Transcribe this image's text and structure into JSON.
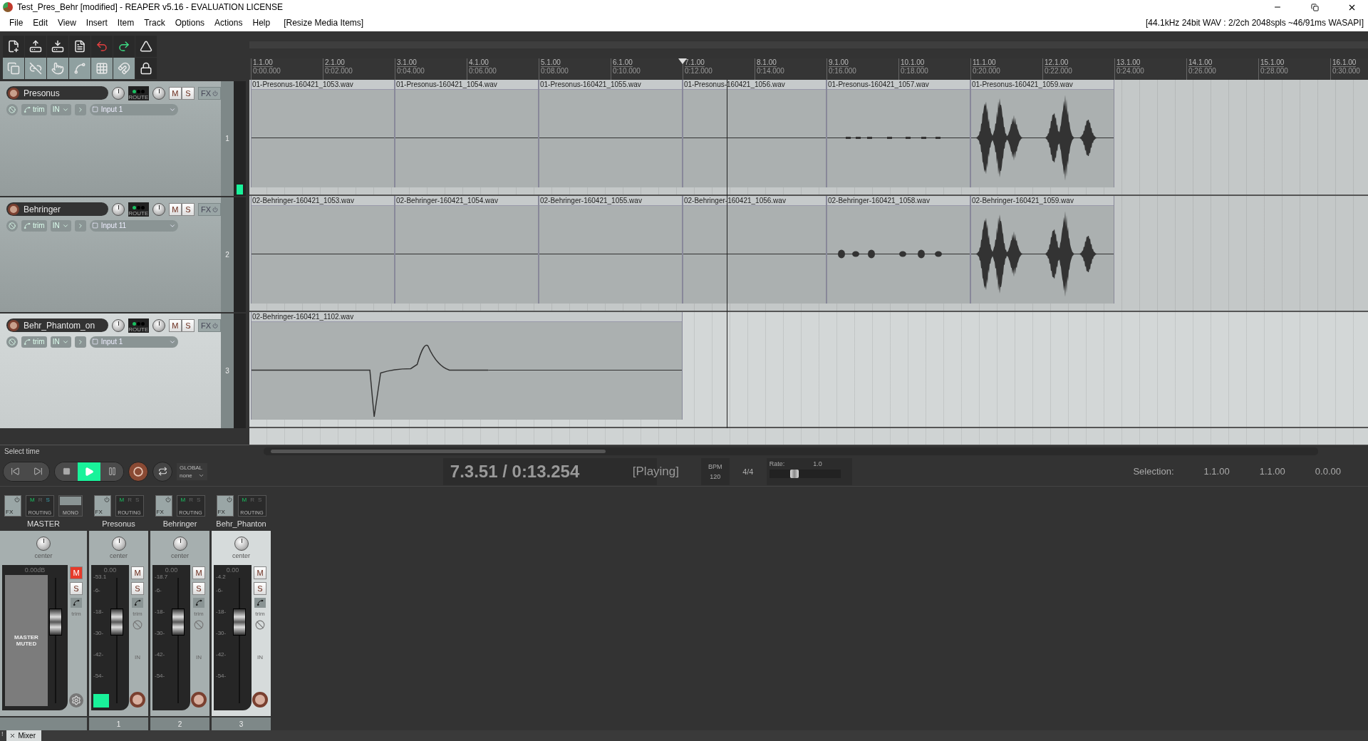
{
  "window": {
    "title": "Test_Pres_Behr [modified] - REAPER v5.16 - EVALUATION LICENSE",
    "device_info": "[44.1kHz 24bit WAV : 2/2ch 2048spls ~46/91ms WASAPI]"
  },
  "menu": [
    "File",
    "Edit",
    "View",
    "Insert",
    "Item",
    "Track",
    "Options",
    "Actions",
    "Help"
  ],
  "menu_extra": "[Resize Media Items]",
  "ruler": [
    {
      "bar": "1.1.00",
      "time": "0:00.000"
    },
    {
      "bar": "2.1.00",
      "time": "0:02.000"
    },
    {
      "bar": "3.1.00",
      "time": "0:04.000"
    },
    {
      "bar": "4.1.00",
      "time": "0:06.000"
    },
    {
      "bar": "5.1.00",
      "time": "0:08.000"
    },
    {
      "bar": "6.1.00",
      "time": "0:10.000"
    },
    {
      "bar": "7.1.00",
      "time": "0:12.000"
    },
    {
      "bar": "8.1.00",
      "time": "0:14.000"
    },
    {
      "bar": "9.1.00",
      "time": "0:16.000"
    },
    {
      "bar": "10.1.00",
      "time": "0:18.000"
    },
    {
      "bar": "11.1.00",
      "time": "0:20.000"
    },
    {
      "bar": "12.1.00",
      "time": "0:22.000"
    },
    {
      "bar": "13.1.00",
      "time": "0:24.000"
    },
    {
      "bar": "14.1.00",
      "time": "0:26.000"
    },
    {
      "bar": "15.1.00",
      "time": "0:28.000"
    },
    {
      "bar": "16.1.00",
      "time": "0:30.000"
    }
  ],
  "tracks": [
    {
      "name": "Presonus",
      "number": "1",
      "selected": false,
      "route_label": "ROUTE",
      "mute_label": "M",
      "solo_label": "S",
      "fx_label": "FX",
      "trim_label": "trim",
      "in_label": "IN",
      "input": "Input 1",
      "items": [
        {
          "name": "01-Presonus-160421_1053.wav",
          "kind": "silent"
        },
        {
          "name": "01-Presonus-160421_1054.wav",
          "kind": "silent"
        },
        {
          "name": "01-Presonus-160421_1055.wav",
          "kind": "silent"
        },
        {
          "name": "01-Presonus-160421_1056.wav",
          "kind": "silent"
        },
        {
          "name": "01-Presonus-160421_1057.wav",
          "kind": "dashes"
        },
        {
          "name": "01-Presonus-160421_1059.wav",
          "kind": "bursts"
        }
      ]
    },
    {
      "name": "Behringer",
      "number": "2",
      "selected": false,
      "route_label": "ROUTE",
      "mute_label": "M",
      "solo_label": "S",
      "fx_label": "FX",
      "trim_label": "trim",
      "in_label": "IN",
      "input": "Input 11",
      "items": [
        {
          "name": "02-Behringer-160421_1053.wav",
          "kind": "silent"
        },
        {
          "name": "02-Behringer-160421_1054.wav",
          "kind": "silent"
        },
        {
          "name": "02-Behringer-160421_1055.wav",
          "kind": "silent"
        },
        {
          "name": "02-Behringer-160421_1056.wav",
          "kind": "silent"
        },
        {
          "name": "02-Behringer-160421_1058.wav",
          "kind": "blobs"
        },
        {
          "name": "02-Behringer-160421_1059.wav",
          "kind": "bursts"
        }
      ]
    },
    {
      "name": "Behr_Phantom_on",
      "number": "3",
      "selected": true,
      "route_label": "ROUTE",
      "mute_label": "M",
      "solo_label": "S",
      "fx_label": "FX",
      "trim_label": "trim",
      "in_label": "IN",
      "input": "Input 1",
      "items": [
        {
          "name": "02-Behringer-160421_1102.wav",
          "kind": "transient"
        }
      ]
    }
  ],
  "status": "Select time",
  "transport": {
    "playing": true,
    "automation_label": "GLOBAL",
    "automation_mode": "none",
    "position": "7.3.51 / 0:13.254",
    "state": "[Playing]",
    "bpm_label": "BPM",
    "bpm": "120",
    "time_signature": "4/4",
    "rate_label": "Rate:",
    "rate": "1.0",
    "rate_slider": {
      "level": 0.35
    },
    "selection_label": "Selection:",
    "selection_start": "1.1.00",
    "selection_end": "1.1.00",
    "selection_length": "0.0.00"
  },
  "mixer": [
    {
      "kind": "master",
      "name": "MASTER",
      "selected": false,
      "fx_label": "FX",
      "routing_label": "ROUTING",
      "routing_flags": [
        "M",
        "R",
        "S"
      ],
      "mono_label": "MONO",
      "pan": "center",
      "volume": "0.00dB",
      "mute_label": "M",
      "solo_label": "S",
      "trim_label": "trim",
      "muted": true,
      "muted_text": "MASTER MUTED",
      "fader": {
        "level": 0.69
      }
    },
    {
      "kind": "track",
      "name": "Presonus",
      "selected": false,
      "fx_label": "FX",
      "routing_label": "ROUTING",
      "routing_flags": [
        "M",
        "R",
        "S"
      ],
      "pan": "center",
      "volume": "0.00",
      "peak": "-53.1",
      "scale": [
        "-6-",
        "-18-",
        "-30-",
        "-42-",
        "-54-"
      ],
      "mute_label": "M",
      "solo_label": "S",
      "trim_label": "trim",
      "in_label": "IN",
      "muted": false,
      "fader": {
        "level": 0.69
      },
      "meter": {
        "level": 0.12
      },
      "number": "1"
    },
    {
      "kind": "track",
      "name": "Behringer",
      "selected": false,
      "fx_label": "FX",
      "routing_label": "ROUTING",
      "routing_flags": [
        "M",
        "R",
        "S"
      ],
      "pan": "center",
      "volume": "0.00",
      "peak": "-18.7",
      "scale": [
        "-6-",
        "-18-",
        "-30-",
        "-42-",
        "-54-"
      ],
      "mute_label": "M",
      "solo_label": "S",
      "trim_label": "trim",
      "in_label": "IN",
      "muted": false,
      "fader": {
        "level": 0.69
      },
      "number": "2"
    },
    {
      "kind": "track",
      "name": "Behr_Phanton",
      "selected": true,
      "fx_label": "FX",
      "routing_label": "ROUTING",
      "routing_flags": [
        "M",
        "R",
        "S"
      ],
      "pan": "center",
      "volume": "0.00",
      "peak": "-4.2",
      "scale": [
        "-6-",
        "-18-",
        "-30-",
        "-42-",
        "-54-"
      ],
      "mute_label": "M",
      "solo_label": "S",
      "trim_label": "trim",
      "in_label": "IN",
      "muted": false,
      "fader": {
        "level": 0.69
      },
      "number": "3"
    }
  ],
  "dock_marker": "!",
  "dock_tab": {
    "label": "Mixer"
  }
}
